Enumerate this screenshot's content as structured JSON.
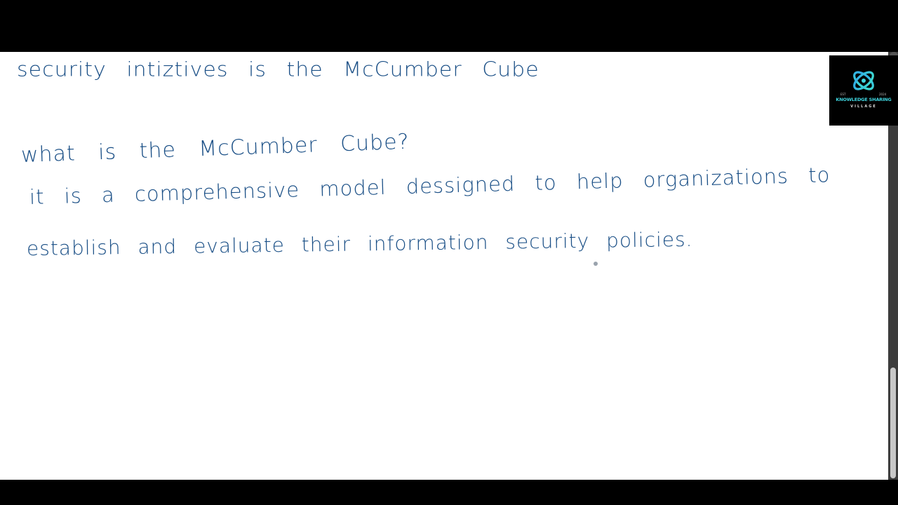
{
  "whiteboard": {
    "lines": [
      "security intiztives is the McCumber Cube",
      "what is the McCumber Cube?",
      "it is a comprehensive model dessigned to help organizations to",
      "establish and evaluate their information security policies."
    ]
  },
  "logo": {
    "est_label": "EST",
    "year_label": "2024",
    "title": "KNOWLEDGE SHARING",
    "subtitle": "VILLAGE",
    "icon": "atom-orbit-icon",
    "accent_color": "#3fd6e0"
  },
  "colors": {
    "ink": "#1a4f86",
    "canvas": "#ffffff",
    "frame": "#000000",
    "scrollbar_track": "#3c3c3c",
    "scrollbar_thumb": "#c8c8c8"
  }
}
